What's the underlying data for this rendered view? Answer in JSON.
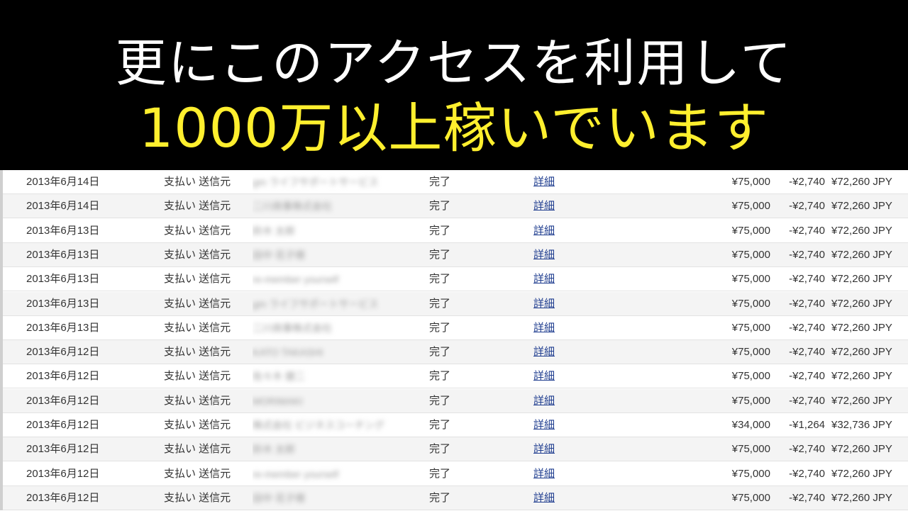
{
  "caption": {
    "line1": "更にこのアクセスを利用して",
    "line2": "1000万以上稼いでいます",
    "line1_color": "#ffffff",
    "line2_color": "#ffef2e",
    "background": "#000000"
  },
  "link_color": "#1f3d8f",
  "transactions": [
    {
      "date": "2013年6月14日",
      "type": "支払い 送信元",
      "name": "gm ライフサポートサービス",
      "status": "完了",
      "detail": "詳細",
      "gross": "¥75,000",
      "fee": "-¥2,740",
      "net": "¥72,260 JPY"
    },
    {
      "date": "2013年6月14日",
      "type": "支払い 送信元",
      "name": "二川商事株式会社",
      "status": "完了",
      "detail": "詳細",
      "gross": "¥75,000",
      "fee": "-¥2,740",
      "net": "¥72,260 JPY"
    },
    {
      "date": "2013年6月13日",
      "type": "支払い 送信元",
      "name": "鈴木 太郎",
      "status": "完了",
      "detail": "詳細",
      "gross": "¥75,000",
      "fee": "-¥2,740",
      "net": "¥72,260 JPY"
    },
    {
      "date": "2013年6月13日",
      "type": "支払い 送信元",
      "name": "田中 花子様",
      "status": "完了",
      "detail": "詳細",
      "gross": "¥75,000",
      "fee": "-¥2,740",
      "net": "¥72,260 JPY"
    },
    {
      "date": "2013年6月13日",
      "type": "支払い 送信元",
      "name": "re-member yourself",
      "status": "完了",
      "detail": "詳細",
      "gross": "¥75,000",
      "fee": "-¥2,740",
      "net": "¥72,260 JPY"
    },
    {
      "date": "2013年6月13日",
      "type": "支払い 送信元",
      "name": "gm ライフサポートサービス",
      "status": "完了",
      "detail": "詳細",
      "gross": "¥75,000",
      "fee": "-¥2,740",
      "net": "¥72,260 JPY"
    },
    {
      "date": "2013年6月13日",
      "type": "支払い 送信元",
      "name": "二川商事株式会社",
      "status": "完了",
      "detail": "詳細",
      "gross": "¥75,000",
      "fee": "-¥2,740",
      "net": "¥72,260 JPY"
    },
    {
      "date": "2013年6月12日",
      "type": "支払い 送信元",
      "name": "KATO TAKASHI",
      "status": "完了",
      "detail": "詳細",
      "gross": "¥75,000",
      "fee": "-¥2,740",
      "net": "¥72,260 JPY"
    },
    {
      "date": "2013年6月12日",
      "type": "支払い 送信元",
      "name": "佐々木 健二",
      "status": "完了",
      "detail": "詳細",
      "gross": "¥75,000",
      "fee": "-¥2,740",
      "net": "¥72,260 JPY"
    },
    {
      "date": "2013年6月12日",
      "type": "支払い 送信元",
      "name": "MORIMAKI",
      "status": "完了",
      "detail": "詳細",
      "gross": "¥75,000",
      "fee": "-¥2,740",
      "net": "¥72,260 JPY"
    },
    {
      "date": "2013年6月12日",
      "type": "支払い 送信元",
      "name": "株式会社 ビジネスコーチング",
      "status": "完了",
      "detail": "詳細",
      "gross": "¥34,000",
      "fee": "-¥1,264",
      "net": "¥32,736 JPY"
    },
    {
      "date": "2013年6月12日",
      "type": "支払い 送信元",
      "name": "鈴木 太郎",
      "status": "完了",
      "detail": "詳細",
      "gross": "¥75,000",
      "fee": "-¥2,740",
      "net": "¥72,260 JPY"
    },
    {
      "date": "2013年6月12日",
      "type": "支払い 送信元",
      "name": "re-member yourself",
      "status": "完了",
      "detail": "詳細",
      "gross": "¥75,000",
      "fee": "-¥2,740",
      "net": "¥72,260 JPY"
    },
    {
      "date": "2013年6月12日",
      "type": "支払い 送信元",
      "name": "田中 花子様",
      "status": "完了",
      "detail": "詳細",
      "gross": "¥75,000",
      "fee": "-¥2,740",
      "net": "¥72,260 JPY"
    }
  ]
}
